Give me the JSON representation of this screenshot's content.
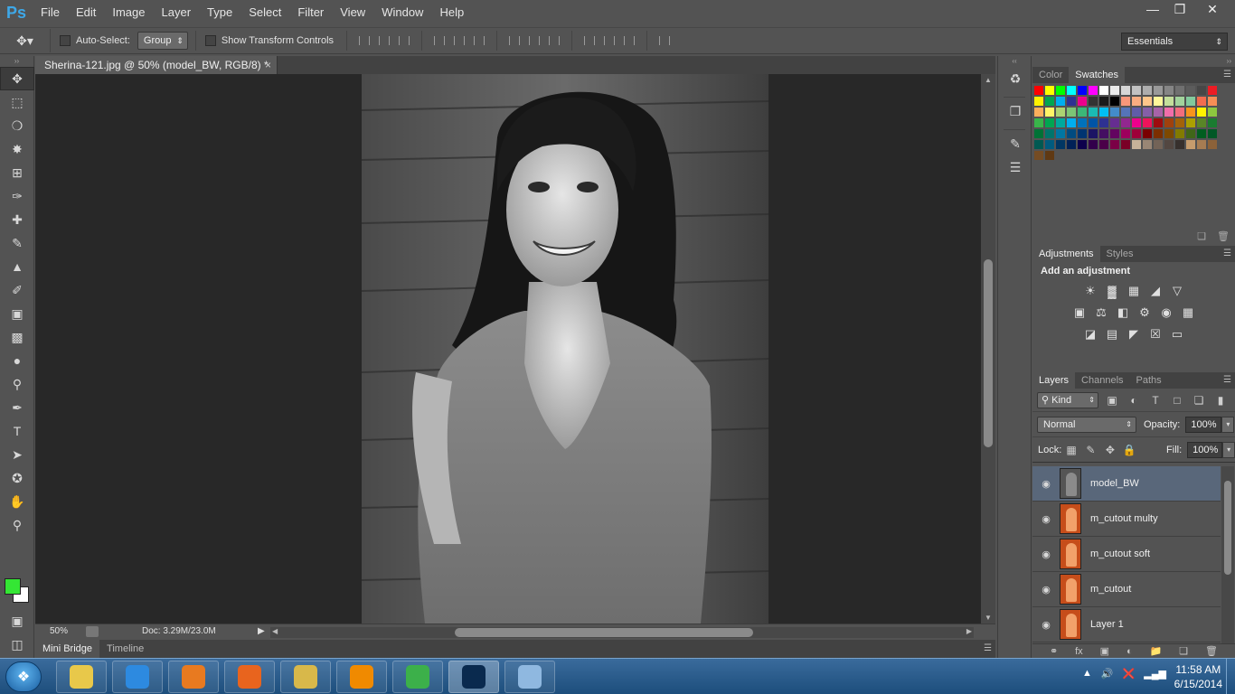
{
  "app": {
    "logo": "Ps"
  },
  "menu": [
    "File",
    "Edit",
    "Image",
    "Layer",
    "Type",
    "Select",
    "Filter",
    "View",
    "Window",
    "Help"
  ],
  "window_controls": {
    "minimize": "—",
    "restore": "❐",
    "close": "✕"
  },
  "options_bar": {
    "auto_select_label": "Auto-Select:",
    "auto_select_value": "Group",
    "show_transform_label": "Show Transform Controls",
    "workspace": "Essentials"
  },
  "document": {
    "tab_title": "Sherina-121.jpg @ 50% (model_BW, RGB/8) *",
    "close": "×",
    "zoom": "50%",
    "doc_size": "Doc: 3.29M/23.0M"
  },
  "bottom_tabs": [
    "Mini Bridge",
    "Timeline"
  ],
  "panels": {
    "color_tab": "Color",
    "swatches_tab": "Swatches",
    "adjustments_tab": "Adjustments",
    "styles_tab": "Styles",
    "add_adjustment": "Add an adjustment",
    "layers_tab": "Layers",
    "channels_tab": "Channels",
    "paths_tab": "Paths"
  },
  "layers": {
    "filter_kind": "Kind",
    "blend_mode": "Normal",
    "opacity_label": "Opacity:",
    "opacity": "100%",
    "lock_label": "Lock:",
    "fill_label": "Fill:",
    "fill": "100%",
    "items": [
      {
        "name": "model_BW",
        "selected": true,
        "thumb": "bw"
      },
      {
        "name": "m_cutout multy",
        "selected": false,
        "thumb": "color"
      },
      {
        "name": "m_cutout soft",
        "selected": false,
        "thumb": "color"
      },
      {
        "name": "m_cutout",
        "selected": false,
        "thumb": "color"
      },
      {
        "name": "Layer 1",
        "selected": false,
        "thumb": "color"
      }
    ]
  },
  "swatch_colors": [
    "#ff0000",
    "#ffff00",
    "#00ff00",
    "#00ffff",
    "#0000ff",
    "#ff00ff",
    "#ffffff",
    "#ebebeb",
    "#d6d6d6",
    "#c2c2c2",
    "#adadad",
    "#999999",
    "#858585",
    "#707070",
    "#5c5c5c",
    "#474747",
    "#ed1c24",
    "#fff200",
    "#00a651",
    "#00aeef",
    "#2e3192",
    "#ec008c",
    "#333333",
    "#1a1a1a",
    "#000000",
    "#f7977a",
    "#f9ad81",
    "#fdc68a",
    "#fff79a",
    "#c4df9b",
    "#a2d39c",
    "#82ca9d",
    "#f26c4f",
    "#f68e55",
    "#fbaf5c",
    "#fff467",
    "#acd372",
    "#7cc576",
    "#3bb878",
    "#1abbb4",
    "#00bff3",
    "#438cca",
    "#5574b9",
    "#605ca8",
    "#855fa8",
    "#a763a8",
    "#f06eaa",
    "#f26d7d",
    "#f7941d",
    "#fff200",
    "#8dc73f",
    "#39b54a",
    "#00a651",
    "#00a99d",
    "#00aeef",
    "#0072bc",
    "#0054a6",
    "#2e3192",
    "#662d91",
    "#92278f",
    "#ec008c",
    "#ed145b",
    "#9e0b0f",
    "#a0410d",
    "#a36209",
    "#aba000",
    "#598527",
    "#1a7b30",
    "#007236",
    "#00746b",
    "#0076a3",
    "#004b80",
    "#003471",
    "#1b1464",
    "#440e62",
    "#630460",
    "#9e005d",
    "#9e0039",
    "#790000",
    "#7b2e00",
    "#7d4900",
    "#827b00",
    "#406618",
    "#005e20",
    "#005826",
    "#005952",
    "#005b7f",
    "#003663",
    "#002157",
    "#0d004c",
    "#32004b",
    "#4b0049",
    "#7b0046",
    "#7a0026",
    "#c7b299",
    "#998675",
    "#736357",
    "#534741",
    "#37302d",
    "#c69c6d",
    "#a67c52",
    "#8c6239",
    "#754c24",
    "#603913"
  ],
  "taskbar": {
    "apps": [
      {
        "name": "Windows Explorer",
        "color": "#e8c84a"
      },
      {
        "name": "Internet Explorer",
        "color": "#2d8ae0"
      },
      {
        "name": "Media Player",
        "color": "#e87a20"
      },
      {
        "name": "Firefox",
        "color": "#e8641e"
      },
      {
        "name": "Files",
        "color": "#d8b84a"
      },
      {
        "name": "VLC",
        "color": "#f08a00"
      },
      {
        "name": "Chrome",
        "color": "#3cb04a"
      },
      {
        "name": "Photoshop",
        "color": "#0a2a4e"
      },
      {
        "name": "Paint",
        "color": "#8fb8e0"
      }
    ],
    "time": "11:58 AM",
    "date": "6/15/2014"
  }
}
